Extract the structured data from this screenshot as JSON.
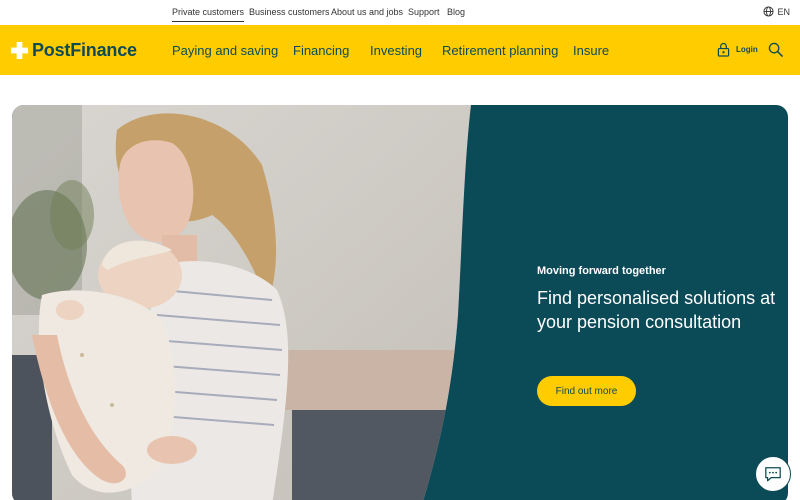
{
  "topbar": {
    "links": [
      "Private customers",
      "Business customers",
      "About us and jobs",
      "Support",
      "Blog"
    ],
    "language": "EN"
  },
  "header": {
    "logo_text": "PostFinance",
    "nav": [
      "Paying and saving",
      "Financing",
      "Investing",
      "Retirement planning",
      "Insure"
    ],
    "login_label": "Login"
  },
  "hero": {
    "eyebrow": "Moving forward together",
    "headline": "Find personalised solutions at your pension consultation",
    "cta_label": "Find out more"
  },
  "colors": {
    "brand_yellow": "#ffcc00",
    "brand_petrol": "#0b4a57"
  },
  "icons": {
    "language": "globe-icon",
    "login": "lock-icon",
    "search": "search-icon",
    "chat": "chat-icon",
    "logo": "cross-icon"
  }
}
